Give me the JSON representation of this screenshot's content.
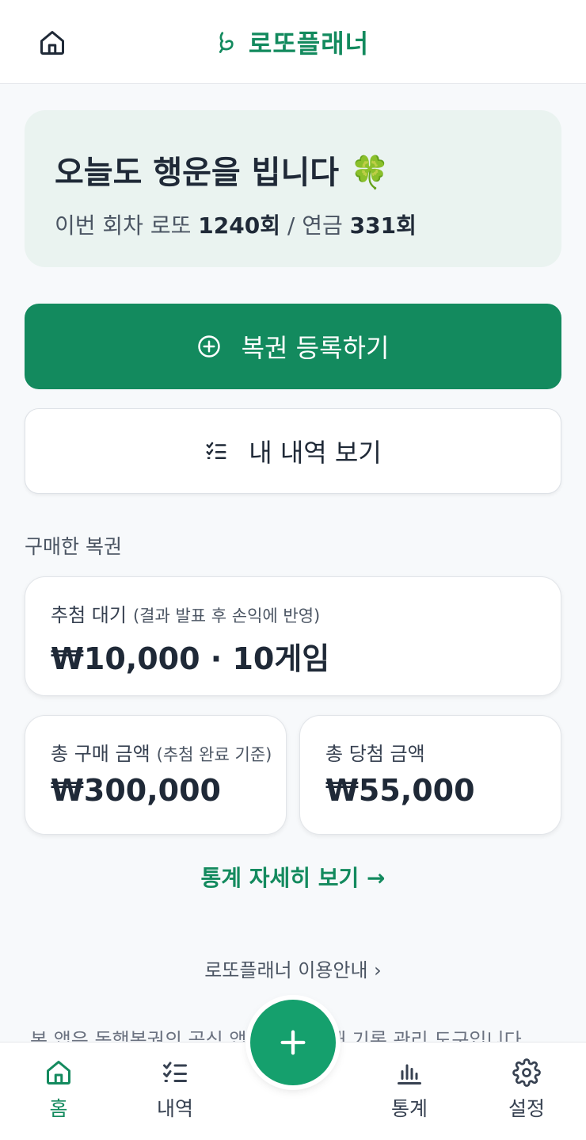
{
  "header": {
    "app_name": "로또플래너"
  },
  "hero": {
    "title": "오늘도 행운을 빕니다 🍀",
    "sub_prefix": "이번 회차 로또 ",
    "lotto_round": "1240회",
    "sub_mid": " / 연금 ",
    "pension_round": "331회"
  },
  "actions": {
    "register_label": "복권 등록하기",
    "history_label": "내 내역 보기"
  },
  "purchased": {
    "section_label": "구매한 복권",
    "pending": {
      "label": "추첨 대기",
      "note": "(결과 발표 후 손익에 반영)",
      "value": "₩10,000 · 10게임"
    },
    "total_purchase": {
      "label": "총 구매 금액",
      "note": "(추첨 완료 기준)",
      "value": "₩300,000"
    },
    "total_win": {
      "label": "총 당첨 금액",
      "value": "₩55,000"
    }
  },
  "links": {
    "stats_detail": "통계 자세히 보기 →",
    "guide": "로또플래너 이용안내 ›",
    "disclaimer": "본 앱은 동행복권의 공식 앱이 아닌 구매 기록 관리 도구입니다."
  },
  "nav": {
    "home": "홈",
    "history": "내역",
    "stats": "통계",
    "settings": "설정"
  },
  "colors": {
    "brand": "#138a5e",
    "fab": "#15a06d"
  }
}
